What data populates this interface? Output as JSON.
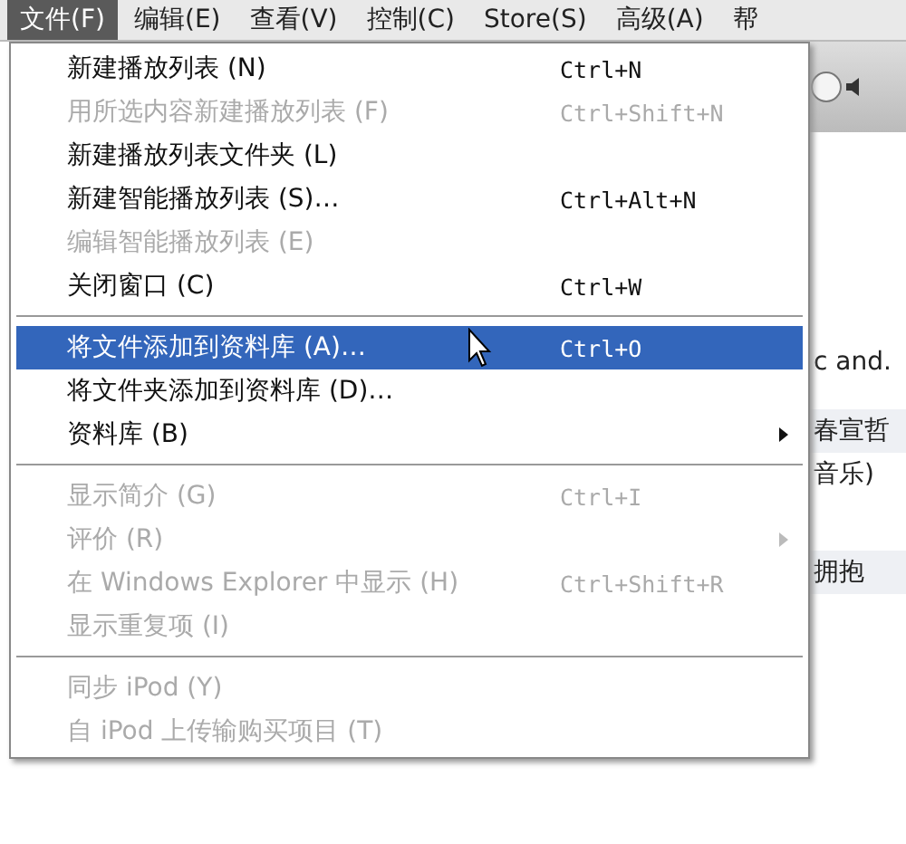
{
  "menubar": [
    {
      "label": "文件(F)",
      "selected": true
    },
    {
      "label": "编辑(E)",
      "selected": false
    },
    {
      "label": "查看(V)",
      "selected": false
    },
    {
      "label": "控制(C)",
      "selected": false
    },
    {
      "label": "Store(S)",
      "selected": false
    },
    {
      "label": "高级(A)",
      "selected": false
    },
    {
      "label": "帮",
      "selected": false
    }
  ],
  "menu": [
    {
      "kind": "item",
      "label": "新建播放列表 (N)",
      "shortcut": "Ctrl+N",
      "disabled": false,
      "selected": false
    },
    {
      "kind": "item",
      "label": "用所选内容新建播放列表 (F)",
      "shortcut": "Ctrl+Shift+N",
      "disabled": true,
      "selected": false
    },
    {
      "kind": "item",
      "label": "新建播放列表文件夹 (L)",
      "disabled": false,
      "selected": false
    },
    {
      "kind": "item",
      "label": "新建智能播放列表 (S)…",
      "shortcut": "Ctrl+Alt+N",
      "disabled": false,
      "selected": false
    },
    {
      "kind": "item",
      "label": "编辑智能播放列表 (E)",
      "disabled": true,
      "selected": false
    },
    {
      "kind": "item",
      "label": "关闭窗口 (C)",
      "shortcut": "Ctrl+W",
      "disabled": false,
      "selected": false
    },
    {
      "kind": "separator"
    },
    {
      "kind": "item",
      "label": "将文件添加到资料库 (A)…",
      "shortcut": "Ctrl+O",
      "disabled": false,
      "selected": true
    },
    {
      "kind": "item",
      "label": "将文件夹添加到资料库 (D)…",
      "disabled": false,
      "selected": false
    },
    {
      "kind": "item",
      "label": "资料库 (B)",
      "disabled": false,
      "selected": false,
      "submenu": true
    },
    {
      "kind": "separator"
    },
    {
      "kind": "item",
      "label": "显示简介 (G)",
      "shortcut": "Ctrl+I",
      "disabled": true,
      "selected": false
    },
    {
      "kind": "item",
      "label": "评价 (R)",
      "disabled": true,
      "selected": false,
      "submenu": true
    },
    {
      "kind": "item",
      "label": "在 Windows Explorer 中显示 (H)",
      "shortcut": "Ctrl+Shift+R",
      "disabled": true,
      "selected": false
    },
    {
      "kind": "item",
      "label": "显示重复项 (I)",
      "disabled": true,
      "selected": false
    },
    {
      "kind": "separator"
    },
    {
      "kind": "item",
      "label": "同步 iPod (Y)",
      "disabled": true,
      "selected": false
    },
    {
      "kind": "item",
      "label": "自 iPod 上传输购买项目 (T)",
      "disabled": true,
      "selected": false
    }
  ],
  "background_list": [
    {
      "text": "c and."
    },
    {
      "text": "春宣哲"
    },
    {
      "text": "音乐)"
    },
    {
      "text": "拥抱"
    }
  ]
}
